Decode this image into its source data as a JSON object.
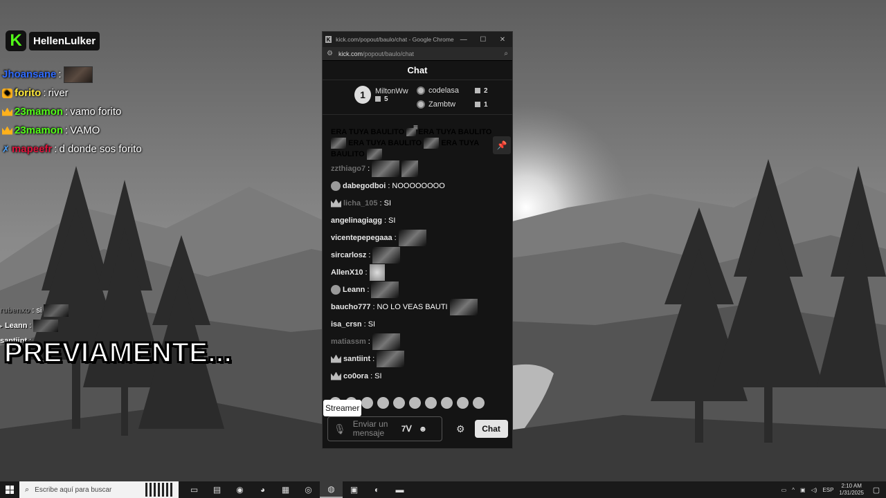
{
  "overlay": {
    "streamer_name": "HellenLulker",
    "logo_letter": "K",
    "chat": [
      {
        "user": "Jhoansane",
        "sep": ":",
        "text": "",
        "color": "#2f6bff",
        "badge": "",
        "emote": true
      },
      {
        "user": "forito",
        "sep": ":",
        "text": "river",
        "color": "#ffe83b",
        "badge": "gift",
        "emote": false
      },
      {
        "user": "23mamon",
        "sep": ":",
        "text": "vamo forito",
        "color": "#53fc18",
        "badge": "crown",
        "emote": false
      },
      {
        "user": "23mamon",
        "sep": ":",
        "text": "VAMO",
        "color": "#53fc18",
        "badge": "crown",
        "emote": false
      },
      {
        "user": "mapeefr",
        "sep": ":",
        "text": "d donde sos forito",
        "color": "#e0143c",
        "badge": "sword",
        "emote": false
      }
    ],
    "mini_chat": [
      {
        "user": "rubenxo",
        "text": ": si"
      },
      {
        "user": "Leann",
        "text": ":"
      },
      {
        "user": "santiint",
        "text": ":"
      }
    ],
    "caption": "PREVIAMENTE..."
  },
  "popup": {
    "window_title": "kick.com/popout/baulo/chat - Google Chrome",
    "url_host": "kick.com",
    "url_path": "/popout/baulo/chat",
    "header": "Chat",
    "leaderboard": {
      "first": {
        "rank": "1",
        "name": "MiltonWw",
        "count": "5"
      },
      "others": [
        {
          "name": "codelasa",
          "count": "2"
        },
        {
          "name": "Zambtw",
          "count": "1"
        }
      ]
    },
    "spam_message": {
      "line1": "ERA TUYA BAULITO",
      "line1b": "ERA TUYA BAULITO",
      "line2": "ERA TUYA BAULITO",
      "line2b": "ERA TUYA",
      "line3": "BAULITO"
    },
    "messages": [
      {
        "user": "zzthiago7",
        "sep": ":",
        "text": "",
        "dim": true,
        "badge": "",
        "emotes": 2
      },
      {
        "user": "dabegodboi",
        "sep": ":",
        "text": "NOOOOOOOO",
        "dim": false,
        "badge": "avatar",
        "emotes": 0
      },
      {
        "user": "licha_105",
        "sep": ":",
        "text": "SI",
        "dim": true,
        "badge": "crown",
        "emotes": 0
      },
      {
        "user": "angelinagiagg",
        "sep": ":",
        "text": "SI",
        "dim": false,
        "badge": "",
        "emotes": 0
      },
      {
        "user": "vicentepepegaaa",
        "sep": ":",
        "text": "",
        "dim": false,
        "badge": "",
        "emotes": 1
      },
      {
        "user": "sircarlosz",
        "sep": ":",
        "text": "",
        "dim": false,
        "badge": "",
        "emotes": 1
      },
      {
        "user": "AllenX10",
        "sep": ":",
        "text": "",
        "dim": false,
        "badge": "",
        "emotes": 1,
        "cat": true
      },
      {
        "user": "Leann",
        "sep": ":",
        "text": "",
        "dim": false,
        "badge": "avatar",
        "emotes": 1
      },
      {
        "user": "baucho777",
        "sep": ":",
        "text": "NO LO VEAS BAUTI",
        "dim": false,
        "badge": "",
        "emotes": 1
      },
      {
        "user": "isa_crsn",
        "sep": ":",
        "text": "SI",
        "dim": false,
        "badge": "",
        "emotes": 0
      },
      {
        "user": "matiassm",
        "sep": ":",
        "text": "",
        "dim": true,
        "badge": "",
        "emotes": 1
      },
      {
        "user": "santiint",
        "sep": ":",
        "text": "",
        "dim": false,
        "badge": "crown",
        "emotes": 1
      },
      {
        "user": "co0ora",
        "sep": ":",
        "text": "SI",
        "dim": false,
        "badge": "crown",
        "emotes": 0
      }
    ],
    "tooltip": "Streamer",
    "input_placeholder": "Enviar un mensaje",
    "send_label": "Chat"
  },
  "taskbar": {
    "search_placeholder": "Escribe aquí para buscar",
    "language": "ESP",
    "time": "2:10 AM",
    "date": "1/31/2025"
  }
}
